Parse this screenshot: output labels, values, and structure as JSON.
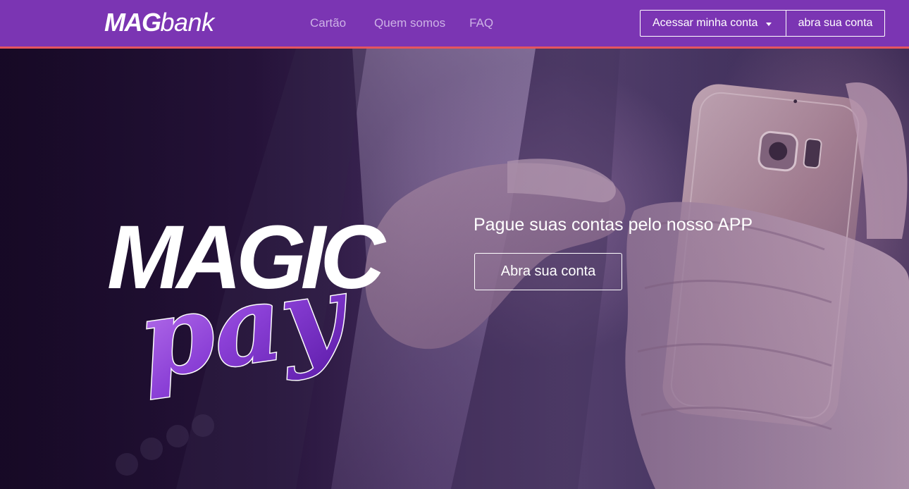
{
  "navbar": {
    "logo": {
      "bold": "MAG",
      "light": "bank"
    },
    "links": [
      "Cartão",
      "Quem somos",
      "FAQ"
    ],
    "access_account_label": "Acessar minha conta",
    "open_account_label": "abra sua conta"
  },
  "hero": {
    "logo_top_word": "MAGIC",
    "logo_script_word": "pay",
    "tagline": "Pague suas contas pelo nosso APP",
    "cta_label": "Abra sua conta"
  },
  "colors": {
    "nav_bg": "#7b35b3",
    "nav_border": "#e5555f",
    "nav_link": "#cdb2e6",
    "script_purple": "#8a3fd6"
  },
  "icons": {
    "dropdown": "caret-down-icon"
  }
}
